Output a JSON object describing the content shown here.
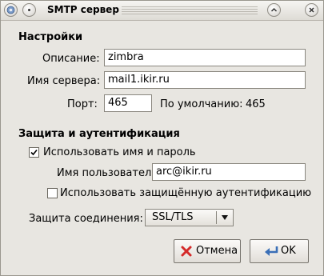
{
  "window": {
    "title": "SMTP сервер",
    "menu_button": "window-menu",
    "minimize_button": "minimize",
    "close_button": "close"
  },
  "settings": {
    "header": "Настройки",
    "description_label": "Описание:",
    "description_value": "zimbra",
    "server_label": "Имя сервера:",
    "server_value": "mail1.ikir.ru",
    "port_label": "Порт:",
    "port_value": "465",
    "default_label": "По умолчанию:",
    "default_value": "465"
  },
  "security": {
    "header": "Защита и аутентификация",
    "use_name_password_label": "Использовать имя и пароль",
    "use_name_password_checked": true,
    "username_label": "Имя пользователя:",
    "username_value": "arc@ikir.ru",
    "secure_auth_label": "Использовать защищённую аутентификацию",
    "secure_auth_checked": false,
    "connection_label": "Защита соединения:",
    "connection_value": "SSL/TLS"
  },
  "buttons": {
    "cancel_label": "Отмена",
    "ok_label": "OK"
  },
  "colors": {
    "window_bg": "#e8e6e1",
    "cancel_icon": "#d42a2a",
    "ok_icon": "#3a6fb7"
  }
}
